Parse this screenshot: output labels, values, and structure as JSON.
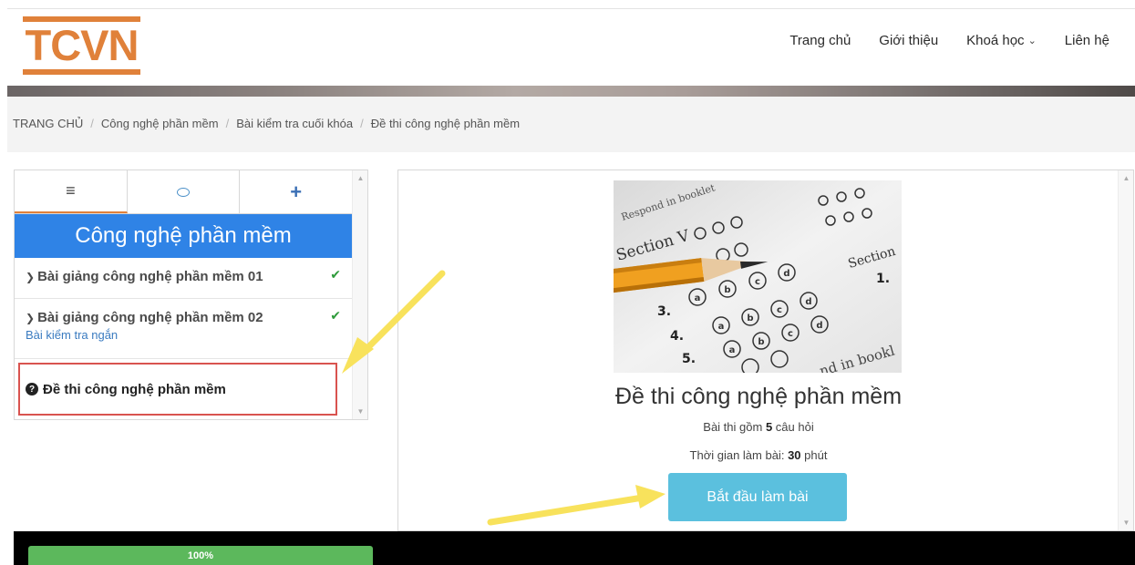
{
  "header": {
    "logo_text": "TCVN",
    "nav": [
      {
        "label": "Trang chủ"
      },
      {
        "label": "Giới thiệu"
      },
      {
        "label": "Khoá học"
      },
      {
        "label": "Liên hệ"
      }
    ]
  },
  "breadcrumb": [
    "TRANG CHỦ",
    "Công nghệ phần mềm",
    "Bài kiểm tra cuối khóa",
    "Đề thi công nghệ phần mềm"
  ],
  "sidebar": {
    "tabs": [
      {
        "icon": "menu-icon"
      },
      {
        "icon": "chat-icon"
      },
      {
        "icon": "plus-icon"
      }
    ],
    "course_title": "Công nghệ phần mềm",
    "lessons": [
      {
        "title": "Bài giảng công nghệ phần mềm 01",
        "completed": true
      },
      {
        "title": "Bài giảng công nghệ phần mềm 02",
        "completed": true,
        "sub": "Bài kiểm tra ngắn"
      }
    ],
    "exam_item": "Đề thi công nghệ phần mềm"
  },
  "exam": {
    "title": "Đề thi công nghệ phần mềm",
    "questions_prefix": "Bài thi gồm ",
    "questions_count": "5",
    "questions_suffix": " câu hỏi",
    "time_prefix": "Thời gian làm bài: ",
    "time_value": "30",
    "time_suffix": " phút",
    "start_button": "Bắt đầu làm bài",
    "image": {
      "label_section": "Section V",
      "label_section_right": "Section",
      "label_respond": "Respond in booklet",
      "label_booklet": "nd in bookl",
      "numbers": [
        "3.",
        "4.",
        "5.",
        "1."
      ],
      "letters": [
        "a",
        "b",
        "c",
        "d"
      ]
    }
  },
  "progress": {
    "label": "100%",
    "value": 1.0
  },
  "colors": {
    "brand": "#e0813a",
    "course_header": "#2f83e6",
    "start_button": "#5bc0de",
    "progress": "#5cb85c",
    "highlight_border": "#d9534f",
    "arrow": "#f8e25c"
  }
}
